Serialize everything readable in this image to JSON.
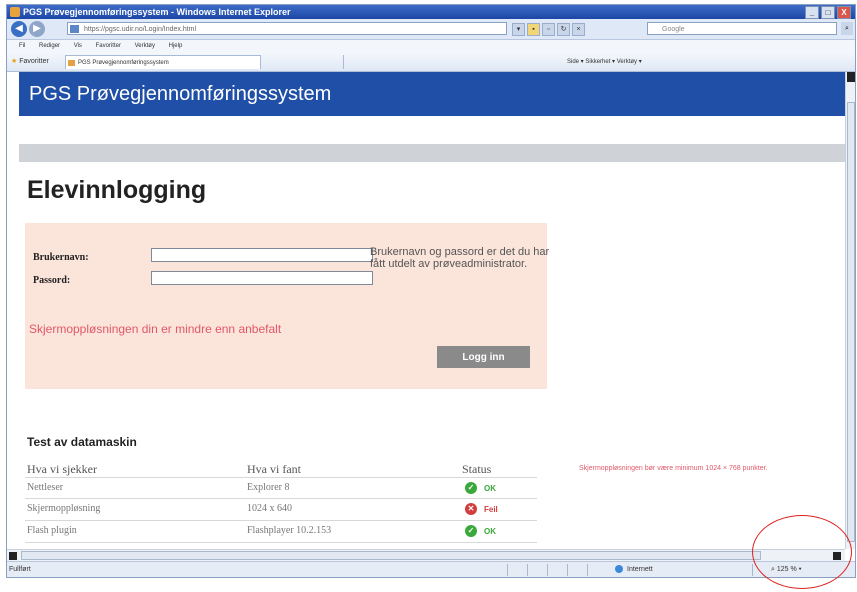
{
  "browser": {
    "window_title": "PGS Prøvegjennomføringssystem - Windows Internet Explorer",
    "window_buttons": [
      "_",
      "□",
      "X"
    ],
    "address": "https://pgsc.udir.no/Login/Index.html",
    "search_placeholder": "Google",
    "menu": [
      "Fil",
      "Rediger",
      "Vis",
      "Favoritter",
      "Verktøy",
      "Hjelp"
    ],
    "favorites_label": "Favoritter",
    "tab_label": "PGS Prøvegjennomføringssystem",
    "command_bar": "Side ▾   Sikkerhet ▾   Verktøy ▾",
    "status_text": "Fullført",
    "zone_text": "Internett",
    "zoom_text": "125 %"
  },
  "page": {
    "banner_title": "PGS Prøvegjennomføringssystem",
    "heading": "Elevinnlogging",
    "login": {
      "username_label": "Brukernavn:",
      "password_label": "Passord:",
      "username_value": "",
      "password_value": "",
      "help_text": "Brukernavn og passord er det du har fått utdelt av prøveadministrator.",
      "warning": "Skjermoppløsningen din er mindre enn anbefalt",
      "button_label": "Logg inn"
    },
    "test": {
      "title": "Test av datamaskin",
      "headers": [
        "Hva vi sjekker",
        "Hva vi fant",
        "Status"
      ],
      "rows": [
        {
          "check": "Nettleser",
          "found": "Explorer 8",
          "status": "OK"
        },
        {
          "check": "Skjermoppløsning",
          "found": "1024 x 640",
          "status": "Feil"
        },
        {
          "check": "Flash plugin",
          "found": "Flashplayer 10.2.153",
          "status": "OK"
        }
      ],
      "side_note": "Skjermoppløsningen bør være minimum 1024 × 768 punkter."
    }
  },
  "colors": {
    "banner": "#1f4fa6",
    "login_box": "#fbe4da",
    "warning": "#e0586a",
    "ok": "#3aa83a",
    "fail": "#d33c3c"
  },
  "icons": {
    "ok": "check-circle-icon",
    "fail": "x-circle-icon"
  }
}
